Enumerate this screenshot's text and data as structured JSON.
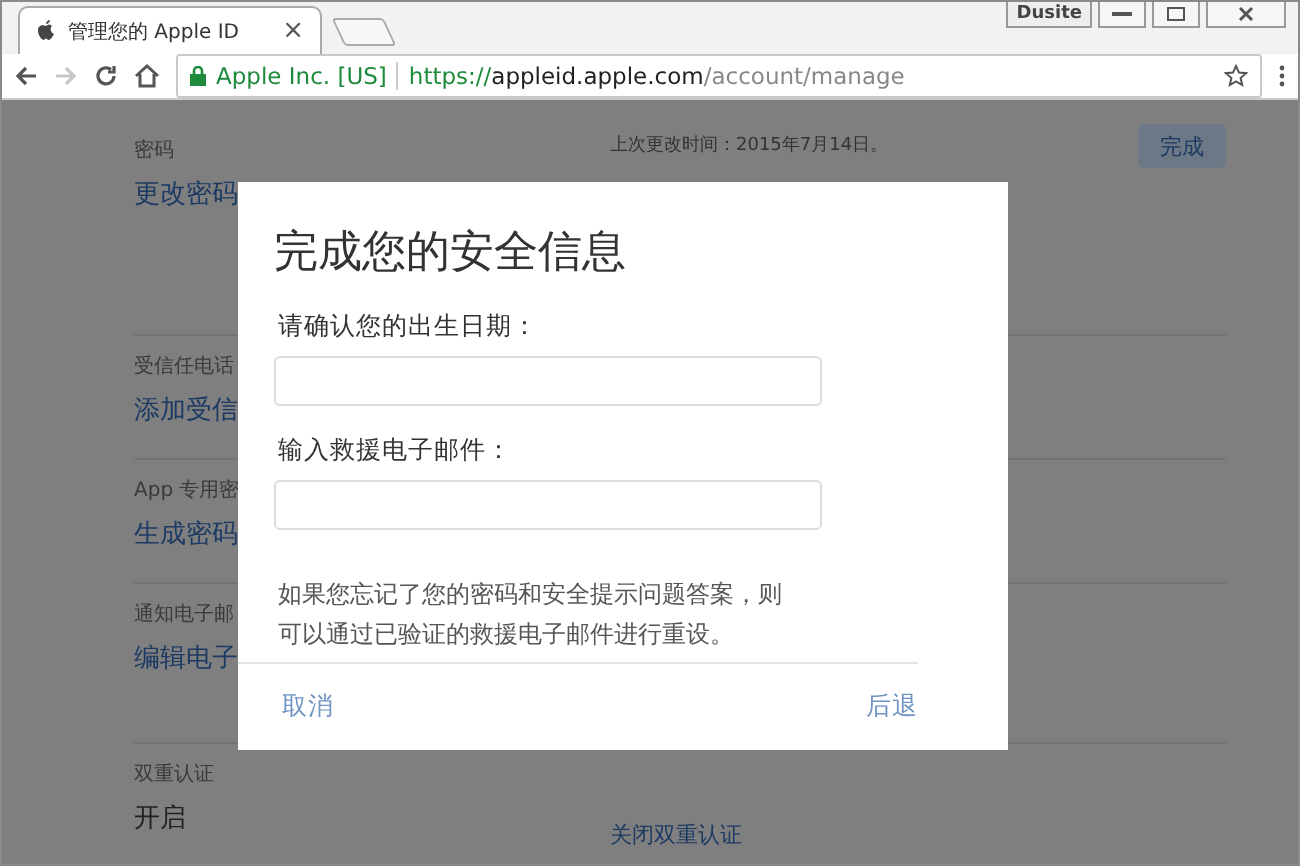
{
  "browser": {
    "profile": "Dusite",
    "tab": {
      "title": "管理您的 Apple ID",
      "close": "×"
    },
    "forward_disabled": true,
    "address": {
      "security_label": "Apple Inc. [US]",
      "scheme": "https://",
      "host": "appleid.apple.com",
      "path": "/account/manage"
    }
  },
  "page": {
    "sections": [
      {
        "label": "密码",
        "link": "更改密码",
        "note": "上次更改时间：2015年7月14日。",
        "button": "完成"
      },
      {
        "label": "受信任电话",
        "link": "添加受信"
      },
      {
        "label": "App 专用密",
        "link": "生成密码"
      },
      {
        "label": "通知电子邮",
        "link": "编辑电子"
      },
      {
        "label": "双重认证",
        "value": "开启",
        "link_right": "关闭双重认证"
      }
    ]
  },
  "dialog": {
    "title": "完成您的安全信息",
    "fields": [
      {
        "label": "请确认您的出生日期："
      },
      {
        "label": "输入救援电子邮件："
      }
    ],
    "message": "如果您忘记了您的密码和安全提示问题答案，则可以通过已验证的救援电子邮件进行重设。",
    "cancel": "取消",
    "back": "后退"
  }
}
